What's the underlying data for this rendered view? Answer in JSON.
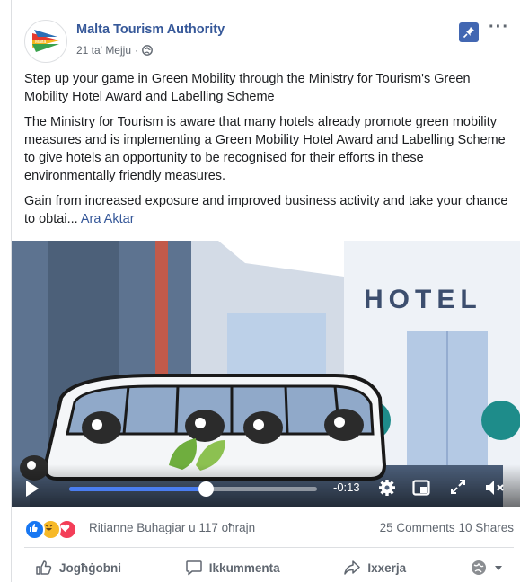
{
  "page": {
    "name": "Malta Tourism Authority",
    "date": "21 ta' Mejju",
    "separator": "·",
    "logo_text": "Malta"
  },
  "post": {
    "paragraphs": [
      "Step up your game in Green Mobility through the Ministry for Tourism's Green Mobility Hotel Award and Labelling Scheme",
      "The Ministry for Tourism is aware that many hotels already promote green mobility measures and is implementing a Green Mobility Hotel Award and Labelling Scheme to give hotels an opportunity to be recognised for their efforts in these environmentally friendly measures."
    ],
    "last_paragraph": "Gain from increased exposure and improved business activity and take your chance to obtai...",
    "see_more": "Ara Aktar"
  },
  "video": {
    "sign_text": "HOTEL",
    "time_remaining": "-0:13",
    "progress": 0.55
  },
  "reactions": {
    "text": "Ritianne Buhagiar u 117 oħrajn",
    "comments": "25 Comments",
    "shares": "10 Shares"
  },
  "actions": {
    "like": "Jogħġobni",
    "comment": "Ikkummenta",
    "share": "Ixxerja"
  },
  "colors": {
    "link": "#365899",
    "accent": "#4267b2",
    "progress": "#4a7df0"
  }
}
